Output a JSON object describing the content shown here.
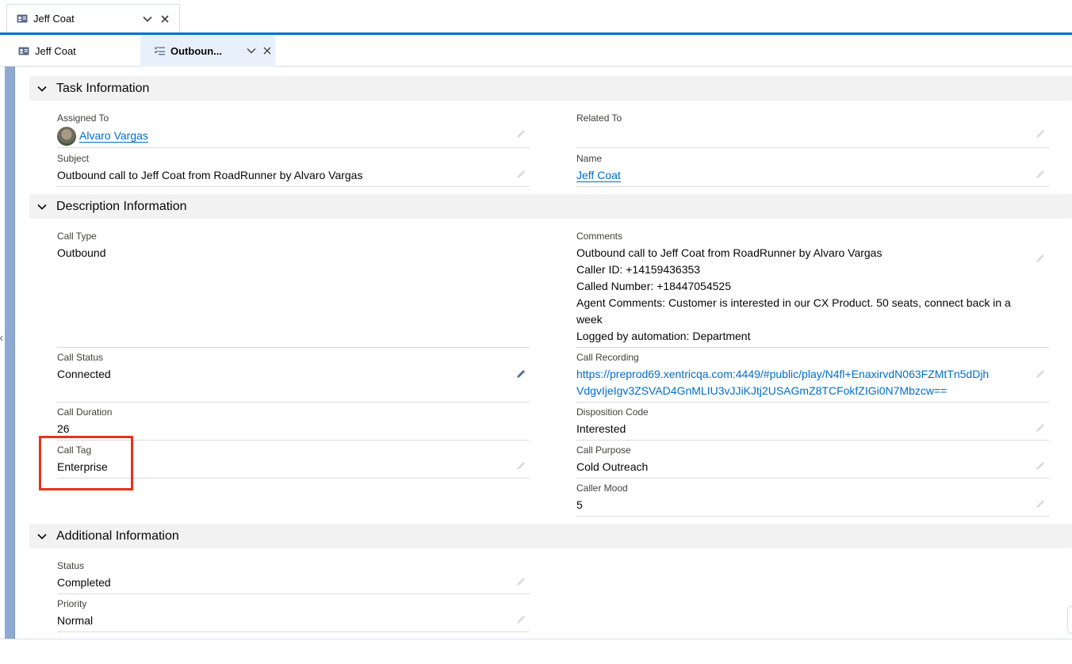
{
  "workspace_tab": {
    "label": "Jeff Coat",
    "icon": "contact-card-icon"
  },
  "sub_tabs": [
    {
      "label": "Jeff Coat",
      "icon": "contact-card-icon"
    },
    {
      "label": "Outboun...",
      "icon": "task-list-icon"
    }
  ],
  "sections": {
    "task": {
      "title": "Task Information",
      "assigned_to": {
        "label": "Assigned To",
        "value": "Alvaro Vargas"
      },
      "related_to": {
        "label": "Related To",
        "value": ""
      },
      "subject": {
        "label": "Subject",
        "value": "Outbound call to Jeff Coat from RoadRunner by Alvaro Vargas"
      },
      "name": {
        "label": "Name",
        "value": "Jeff Coat"
      }
    },
    "description": {
      "title": "Description Information",
      "call_type": {
        "label": "Call Type",
        "value": "Outbound"
      },
      "comments": {
        "label": "Comments",
        "lines": [
          "Outbound call to Jeff Coat from RoadRunner by Alvaro Vargas",
          "Caller ID: +14159436353",
          "Called Number: +18447054525",
          "Agent Comments: Customer is interested in our CX Product. 50 seats, connect back in a week",
          "Logged by automation: Department"
        ]
      },
      "call_status": {
        "label": "Call Status",
        "value": "Connected"
      },
      "call_recording": {
        "label": "Call Recording",
        "line1": "https://preprod69.xentricqa.com:4449/#public/play/N4fl+EnaxirvdN063FZMtTn5dDjh",
        "line2": "VdgvIjeIgv3ZSVAD4GnMLIU3vJJiKJtj2USAGmZ8TCFokfZIGi0N7Mbzcw=="
      },
      "call_duration": {
        "label": "Call Duration",
        "value": "26"
      },
      "disposition_code": {
        "label": "Disposition Code",
        "value": "Interested"
      },
      "call_tag": {
        "label": "Call Tag",
        "value": "Enterprise"
      },
      "call_purpose": {
        "label": "Call Purpose",
        "value": "Cold Outreach"
      },
      "caller_mood": {
        "label": "Caller Mood",
        "value": "5"
      }
    },
    "additional": {
      "title": "Additional Information",
      "status": {
        "label": "Status",
        "value": "Completed"
      },
      "priority": {
        "label": "Priority",
        "value": "Normal"
      }
    }
  },
  "colors": {
    "accent": "#0070d2",
    "link": "#006dcc",
    "highlight": "#e8321b",
    "section_bg": "#f3f2f2"
  }
}
